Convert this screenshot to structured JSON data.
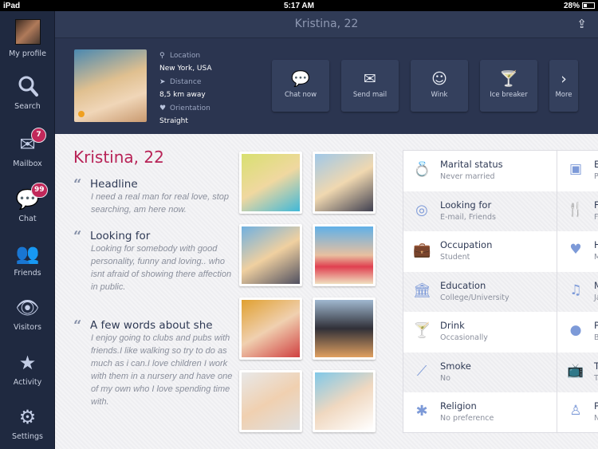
{
  "status": {
    "device": "iPad",
    "time": "5:17 AM",
    "battery": "28%"
  },
  "sidebar": {
    "items": [
      {
        "label": "My profile",
        "icon": "avatar"
      },
      {
        "label": "Search",
        "icon": "search-icon"
      },
      {
        "label": "Mailbox",
        "icon": "mail-icon",
        "badge": "7"
      },
      {
        "label": "Chat",
        "icon": "chat-icon",
        "badge": "99"
      },
      {
        "label": "Friends",
        "icon": "friends-icon"
      },
      {
        "label": "Visitors",
        "icon": "eye-icon"
      },
      {
        "label": "Activity",
        "icon": "star-icon"
      },
      {
        "label": "Settings",
        "icon": "gear-icon"
      }
    ]
  },
  "header": {
    "title": "Kristina, 22"
  },
  "profile": {
    "location_label": "Location",
    "location": "New York, USA",
    "distance_label": "Distance",
    "distance": "8,5 km away",
    "orientation_label": "Orientation",
    "orientation": "Straight",
    "online_color": "#f0a020"
  },
  "actions": [
    {
      "label": "Chat now",
      "icon": "chat-icon"
    },
    {
      "label": "Send mail",
      "icon": "mail-icon"
    },
    {
      "label": "Wink",
      "icon": "wink-icon"
    },
    {
      "label": "Ice breaker",
      "icon": "cocktail-icon"
    },
    {
      "label": "More",
      "icon": "chevron-right-icon"
    }
  ],
  "main": {
    "name": "Kristina, 22",
    "sections": [
      {
        "title": "Headline",
        "text": "I need a real man for real love, stop searching, am here now."
      },
      {
        "title": "Looking for",
        "text": "Looking for somebody with good personality, funny and loving.. who isnt afraid of showing there affection in public."
      },
      {
        "title": "A few words about she",
        "text": "I enjoy going to clubs and pubs with friends.I like walking so try to do as much as i can.I love children I work with them in a nursery and have one of my own who I love spending time with."
      }
    ]
  },
  "details": [
    {
      "title": "Marital status",
      "value": "Never married",
      "icon": "ring-icon",
      "title2": "E",
      "value2": "P",
      "icon2": "image-icon"
    },
    {
      "title": "Looking for",
      "value": "E-mail, Friends",
      "icon": "target-icon",
      "title2": "F",
      "value2": "F",
      "icon2": "fork-knife-icon"
    },
    {
      "title": "Occupation",
      "value": "Student",
      "icon": "briefcase-icon",
      "title2": "H",
      "value2": "M",
      "icon2": "heart-icon"
    },
    {
      "title": "Education",
      "value": "College/University",
      "icon": "bank-icon",
      "title2": "M",
      "value2": "Ja",
      "icon2": "music-icon"
    },
    {
      "title": "Drink",
      "value": "Occasionally",
      "icon": "cocktail-icon",
      "title2": "P",
      "value2": "B",
      "icon2": "basketball-icon"
    },
    {
      "title": "Smoke",
      "value": "No",
      "icon": "cigarette-icon",
      "title2": "T",
      "value2": "Ta",
      "icon2": "tv-icon"
    },
    {
      "title": "Religion",
      "value": "No preference",
      "icon": "religion-cross-icon",
      "title2": "P",
      "value2": "N",
      "icon2": "politics-icon"
    }
  ],
  "colors": {
    "sidebar": "#1f2940",
    "header": "#303b56",
    "accent": "#b82357",
    "badge": "#c2285a",
    "icon": "#7d9ad8"
  }
}
